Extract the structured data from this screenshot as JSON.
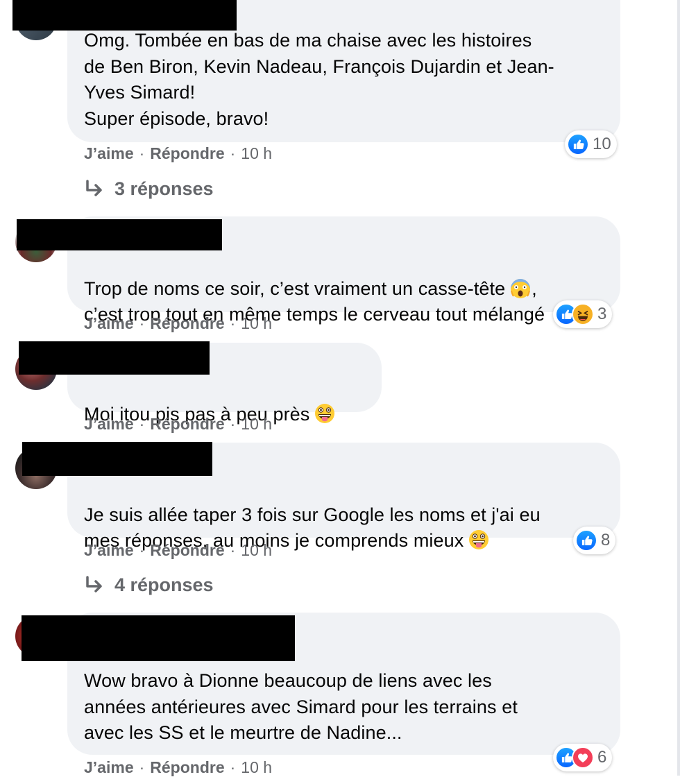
{
  "comments": [
    {
      "text_lines": "Omg. Tombée en bas de ma chaise avec les histoires\nde Ben Biron, Kevin Nadeau, François Dujardin et Jean-\nYves Simard!\nSuper épisode, bravo!",
      "actions": {
        "like": "J’aime",
        "reply": "Répondre",
        "time": "10 h"
      },
      "reaction_count": "10",
      "reaction_icons": [
        "like"
      ],
      "replies_label": "3 réponses"
    },
    {
      "text_a": "Trop de noms ce soir, c’est vraiment un casse-tête",
      "text_b": ",",
      "text_c": "c’est trop tout en même temps le cerveau tout mélangé",
      "emoji": "scream-emoji",
      "actions": {
        "like": "J’aime",
        "reply": "Répondre",
        "time": "10 h"
      },
      "reaction_count": "3",
      "reaction_icons": [
        "like",
        "haha"
      ]
    },
    {
      "text_a": "Moi itou pis pas à peu près",
      "emoji": "tongue-emoji",
      "actions": {
        "like": "J’aime",
        "reply": "Répondre",
        "time": "10 h"
      }
    },
    {
      "text_a": "Je suis allée taper 3 fois sur Google les noms et j'ai eu",
      "text_b": "mes réponses, au moins je comprends mieux",
      "emoji": "tongue-emoji",
      "actions": {
        "like": "J’aime",
        "reply": "Répondre",
        "time": "10 h"
      },
      "reaction_count": "8",
      "reaction_icons": [
        "like"
      ],
      "replies_label": "4 réponses"
    },
    {
      "text_lines": "Wow bravo à Dionne beaucoup de liens avec les\nannées antérieures avec Simard pour les terrains et\navec les SS et le meurtre de Nadine...",
      "actions": {
        "like": "J’aime",
        "reply": "Répondre",
        "time": "10 h"
      },
      "reaction_count": "6",
      "reaction_icons": [
        "like",
        "love"
      ]
    }
  ],
  "colors": {
    "bubble": "#f0f2f5",
    "meta": "#65676b",
    "like": "#0866ff",
    "love": "#f33e58",
    "haha": "#f7b125"
  }
}
